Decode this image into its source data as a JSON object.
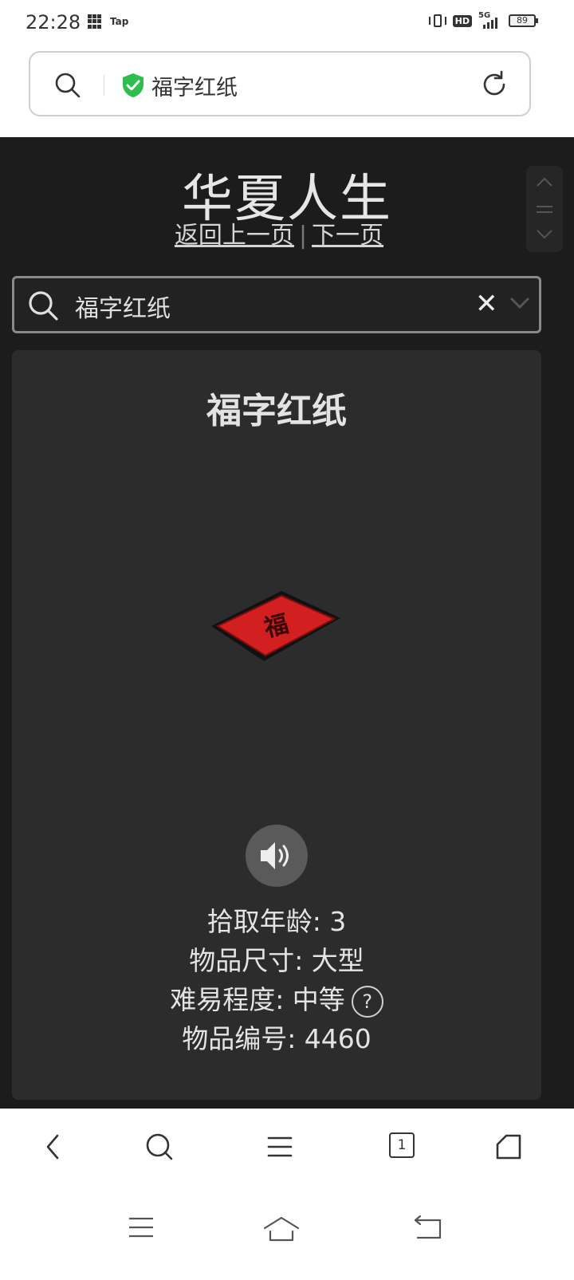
{
  "status_bar": {
    "time": "22:28",
    "app_label": "Tap",
    "hd_label": "HD",
    "network": "5G",
    "battery": "89"
  },
  "browser": {
    "url_text": "福字红纸",
    "icons": [
      "search-icon",
      "shield-icon",
      "reload-icon"
    ]
  },
  "header": {
    "site_title": "华夏人生",
    "prev_link": "返回上一页",
    "separator": "|",
    "next_link": "下一页"
  },
  "search": {
    "value": "福字红纸",
    "clear_label": "✕"
  },
  "item": {
    "name": "福字红纸",
    "image_label": "福",
    "pickup_age": "拾取年龄: 3",
    "size": "物品尺寸: 大型",
    "difficulty": "难易程度: 中等",
    "help_label": "?",
    "item_no": "物品编号: 4460"
  },
  "bottom_nav": {
    "tab_count": "1",
    "icons": [
      "back-icon",
      "search-icon",
      "menu-icon",
      "tabs-icon",
      "home-icon"
    ]
  },
  "system_nav": {
    "icons": [
      "menu-icon",
      "home-icon",
      "back-icon"
    ]
  },
  "colors": {
    "page_bg": "#1c1c1c",
    "card_bg": "#2c2c2c",
    "paper_red": "#d21f1f",
    "shield_green": "#2dbe4e"
  }
}
